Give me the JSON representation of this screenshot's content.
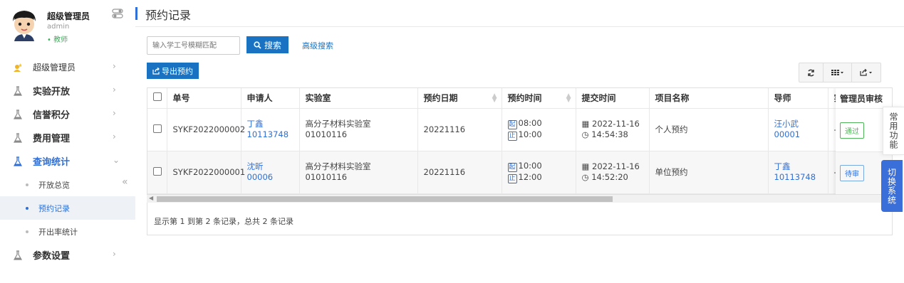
{
  "user": {
    "name": "超级管理员",
    "account": "admin",
    "role": "• 教师"
  },
  "nav": {
    "items": [
      {
        "label": "超级管理员"
      },
      {
        "label": "实验开放"
      },
      {
        "label": "信誉积分"
      },
      {
        "label": "费用管理"
      },
      {
        "label": "查询统计"
      },
      {
        "label": "参数设置"
      }
    ],
    "sub_items": [
      {
        "label": "开放总览"
      },
      {
        "label": "预约记录"
      },
      {
        "label": "开出率统计"
      }
    ],
    "chevron_right": "›",
    "chevron_down": "⌄",
    "collapse": "«"
  },
  "header": {
    "title": "预约记录"
  },
  "toolbar": {
    "search_placeholder": "输入学工号模糊匹配",
    "search_label": "搜索",
    "advanced_label": "高级搜索",
    "export_label": "导出预约"
  },
  "table": {
    "columns": [
      "单号",
      "申请人",
      "实验室",
      "预约日期",
      "预约时间",
      "提交时间",
      "项目名称",
      "导师",
      "实"
    ],
    "fixed_column": "管理员审核",
    "rows": [
      {
        "id": "SYKF2022000002",
        "applicant_name": "丁鑫",
        "applicant_no": "10113748",
        "lab_name": "高分子材料实验室",
        "lab_no": "01010116",
        "date": "20221116",
        "start_tag": "起",
        "start": "08:00",
        "end_tag": "止",
        "end": "10:00",
        "submit_date": "2022-11-16",
        "submit_time": "14:54:38",
        "project": "个人预约",
        "tutor_name": "汪小武",
        "tutor_no": "00001",
        "extra": "-",
        "status": "通过"
      },
      {
        "id": "SYKF2022000001",
        "applicant_name": "沈昕",
        "applicant_no": "00006",
        "lab_name": "高分子材料实验室",
        "lab_no": "01010116",
        "date": "20221116",
        "start_tag": "起",
        "start": "10:00",
        "end_tag": "止",
        "end": "12:00",
        "submit_date": "2022-11-16",
        "submit_time": "14:52:20",
        "project": "单位预约",
        "tutor_name": "丁鑫",
        "tutor_no": "10113748",
        "extra": "-",
        "status": "待审"
      }
    ]
  },
  "summary": "显示第 1 到第 2 条记录，总共 2 条记录",
  "float": {
    "common": "常用功能",
    "switch": "切换系统"
  },
  "colors": {
    "accent": "#1a73c2",
    "link": "#2f6fd6",
    "pass": "#52b45a",
    "switch_tab": "#3a6ed8"
  }
}
